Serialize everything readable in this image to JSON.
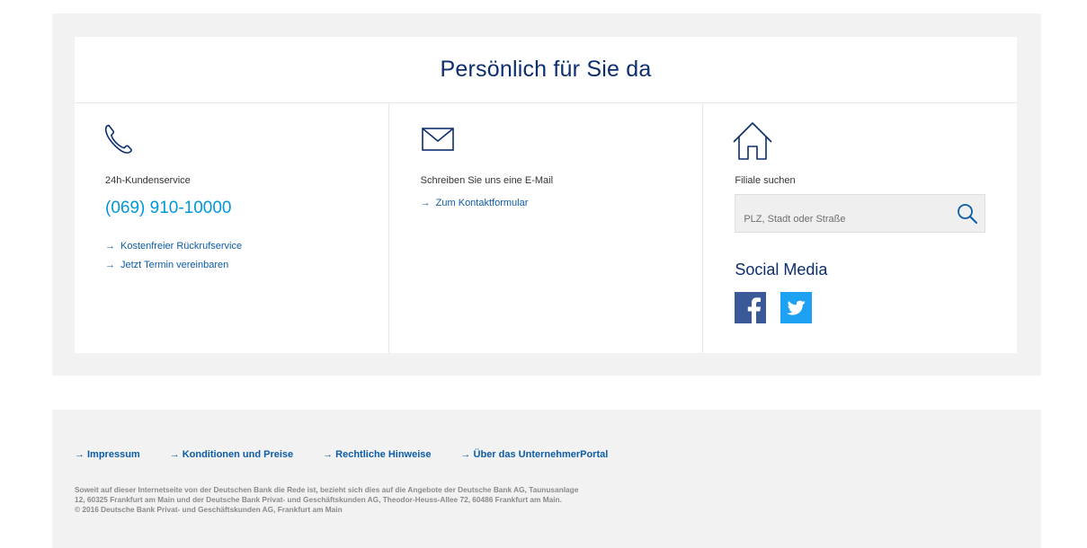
{
  "contact": {
    "title": "Persönlich für Sie da",
    "phone_col": {
      "icon": "phone-icon",
      "label": "24h-Kundenservice",
      "phone_number": "(069) 910-10000",
      "links": [
        "Kostenfreier Rückrufservice",
        "Jetzt Termin vereinbaren"
      ]
    },
    "email_col": {
      "icon": "mail-icon",
      "label": "Schreiben Sie uns eine E-Mail",
      "link": "Zum Kontaktformular"
    },
    "branch_col": {
      "icon": "house-icon",
      "label": "Filiale suchen",
      "search_placeholder": "PLZ, Stadt oder Straße",
      "search_icon": "search-icon",
      "social_title": "Social Media",
      "social": [
        {
          "name": "facebook",
          "icon": "facebook-icon",
          "color": "#3b5998"
        },
        {
          "name": "twitter",
          "icon": "twitter-icon",
          "color": "#1da1f2"
        }
      ]
    }
  },
  "footer": {
    "links": [
      "Impressum",
      "Konditionen und Preise",
      "Rechtliche Hinweise",
      "Über das UnternehmerPortal"
    ],
    "legal_line1": "Soweit auf dieser Internetseite von der Deutschen Bank die Rede ist, bezieht sich dies auf die Angebote der Deutsche Bank AG, Taunusanlage",
    "legal_line2": "12, 60325 Frankfurt am Main und der Deutsche Bank Privat- und Geschäftskunden AG, Theodor-Heuss-Allee 72, 60486 Frankfurt am Main.",
    "legal_line3": "© 2016 Deutsche Bank Privat- und Geschäftskunden AG, Frankfurt am Main"
  },
  "colors": {
    "title": "#0c2e6e",
    "link": "#0c5ca8",
    "phone": "#0098db",
    "panel_bg": "#f2f2f2"
  }
}
